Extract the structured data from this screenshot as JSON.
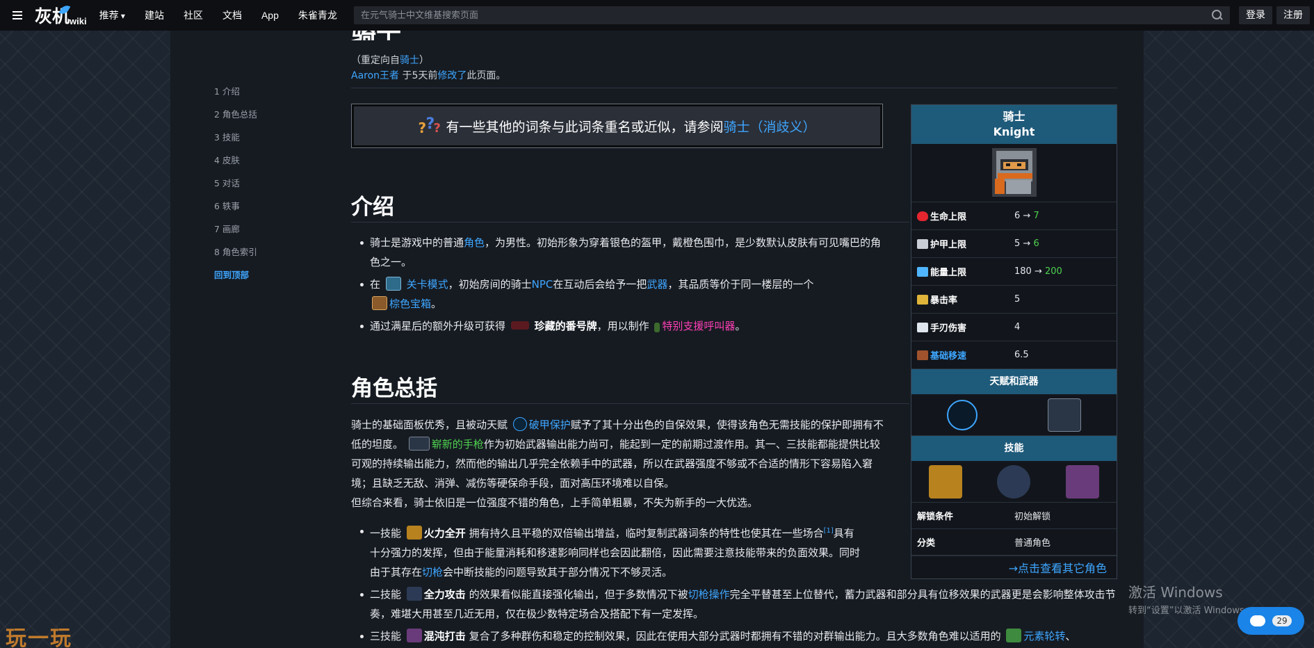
{
  "topbar": {
    "logo": "灰机",
    "logo_suffix": "wiki",
    "nav": [
      "推荐",
      "建站",
      "社区",
      "文档",
      "App",
      "朱雀青龙"
    ],
    "search_placeholder": "在元气骑士中文维基搜索页面",
    "login": "登录",
    "register": "注册"
  },
  "page": {
    "title": "骑士",
    "redirect_prefix": "（重定向自",
    "redirect_link": "骑士",
    "redirect_suffix": "）",
    "editor": "Aaron王者",
    "edit_mid": " 于5天前",
    "edit_link": "修改了",
    "edit_suffix": "此页面。"
  },
  "toc": [
    "1 介绍",
    "2 角色总括",
    "3 技能",
    "4 皮肤",
    "5 对话",
    "6 轶事",
    "7 画廊",
    "8 角色索引",
    "回到顶部"
  ],
  "disambig": {
    "text": "有一些其他的词条与此词条重名或近似，请参阅",
    "link": "骑士（消歧义）"
  },
  "intro": {
    "heading": "介绍",
    "b1_a": "骑士是游戏中的普通",
    "b1_link": "角色",
    "b1_b": "，为男性。初始形象为穿着银色的盔甲，戴橙色围巾，是少数默认皮肤有可见嘴巴的角色之一。",
    "b2_a": "在",
    "b2_link1": "关卡模式",
    "b2_b": "，初始房间的骑士",
    "b2_link2": "NPC",
    "b2_c": "在互动后会给予一把",
    "b2_link3": "武器",
    "b2_d": "，其品质等价于同一楼层的一个",
    "b2_link4": "棕色宝箱",
    "b2_e": "。",
    "b3_a": "通过满星后的额外升级可获得",
    "b3_bold": "珍藏的番号牌",
    "b3_b": "，用以制作",
    "b3_link": "特别支援呼叫器",
    "b3_c": "。"
  },
  "summary": {
    "heading": "角色总括",
    "p1_a": "骑士的基础面板优秀，且被动天赋",
    "p1_link1": "破甲保护",
    "p1_b": "赋予了其十分出色的自保效果，使得该角色无需技能的保护即拥有不低的坦度。",
    "p1_link2": "崭新的手枪",
    "p1_c": "作为初始武器输出能力尚可，能起到一定的前期过渡作用。其一、三技能都能提供比较可观的持续输出能力，然而他的输出几乎完全依赖手中的武器，所以在武器强度不够或不合适的情形下容易陷入窘境；且缺乏无敌、消弹、减伤等硬保命手段，面对高压环境难以自保。",
    "p2": "但综合来看，骑士依旧是一位强度不错的角色，上手简单粗暴，不失为新手的一大优选。",
    "s1_a": "一技能",
    "s1_bold": "火力全开",
    "s1_b": " 拥有持久且平稳的双倍输出增益，临时复制武器词条的特性也使其在一些场合",
    "s1_ref": "[1]",
    "s1_c": "具有十分强力的发挥，但由于能量消耗和移速影响同样也会因此翻倍，因此需要注意技能带来的负面效果。同时由于其存在",
    "s1_link": "切枪",
    "s1_d": "会中断技能的问题导致其于部分情况下不够灵活。",
    "s2_a": "二技能",
    "s2_bold": "全力攻击",
    "s2_b": " 的效果看似能直接强化输出，但于多数情况下被",
    "s2_link": "切枪操作",
    "s2_c": "完全平替甚至上位替代，蓄力武器和部分具有位移效果的武器更是会影响整体攻击节奏，难堪大用甚至几近无用，仅在极少数特定场合及搭配下有一定发挥。",
    "s3_a": "三技能",
    "s3_bold": "混沌打击",
    "s3_b": " 复合了多种群伤和稳定的控制效果，因此在使用大部分武器时都拥有不错的对群输出能力。且大多数角色难以适用的",
    "s3_link": "元素轮转",
    "s3_c": "、"
  },
  "infobox": {
    "name_cn": "骑士",
    "name_en": "Knight",
    "stats": [
      {
        "label": "生命上限",
        "base": "6",
        "arrow": " → ",
        "max": "7",
        "icon": "heart-icon",
        "color": "#e5262f"
      },
      {
        "label": "护甲上限",
        "base": "5",
        "arrow": " → ",
        "max": "6",
        "icon": "shield-icon",
        "color": "#c9ced6"
      },
      {
        "label": "能量上限",
        "base": "180",
        "arrow": " → ",
        "max": "200",
        "icon": "energy-icon",
        "color": "#4fb6ff"
      },
      {
        "label": "暴击率",
        "value": "5",
        "icon": "crit-icon",
        "color": "#e0b43a"
      },
      {
        "label": "手刃伤害",
        "value": "4",
        "icon": "slash-icon",
        "color": "#dfe6ee"
      },
      {
        "label": "基础移速",
        "value": "6.5",
        "icon": "boot-icon",
        "color": "#a0522d"
      }
    ],
    "talent_weapon_title": "天赋和武器",
    "skills_title": "技能",
    "unlock_label": "解锁条件",
    "unlock_value": "初始解锁",
    "class_label": "分类",
    "class_value": "普通角色",
    "more_link": "→点击查看其它角色"
  },
  "overlay": {
    "activate_title": "激活 Windows",
    "activate_sub": "转到“设置”以激活 Windows。",
    "chat_count": "29",
    "corner_logo": "玩一玩"
  }
}
